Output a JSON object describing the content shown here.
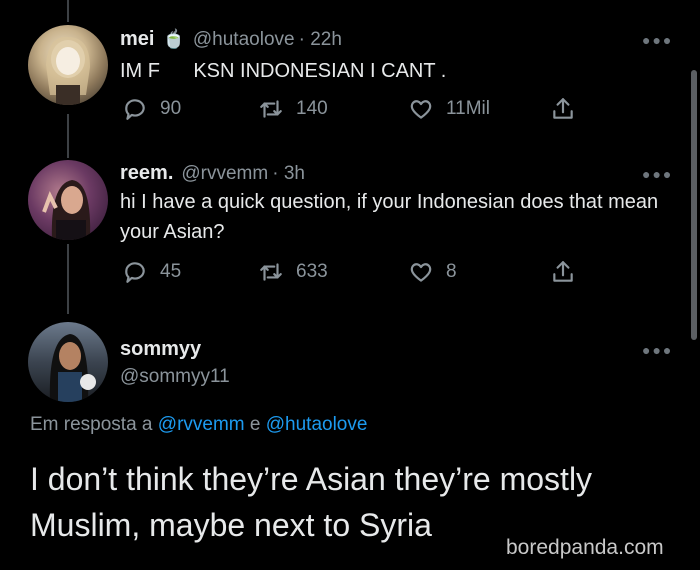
{
  "tweets": [
    {
      "name": "mei",
      "emoji": "🍵",
      "handle": "@hutaolove",
      "time": "· 22h",
      "text": "IM F      KSN INDONESIAN I CANT .",
      "replies": "90",
      "retweets": "140",
      "likes": "11Mil"
    },
    {
      "name": "reem.",
      "handle": "@rvvemm",
      "time": "· 3h",
      "text": "hi I have a quick question, if your Indonesian does that mean your Asian?",
      "replies": "45",
      "retweets": "633",
      "likes": "8"
    }
  ],
  "main_tweet": {
    "name": "sommyy",
    "handle": "@sommyy11",
    "reply_prefix": "Em resposta a ",
    "reply_user1": "@rvvemm",
    "reply_join": " e ",
    "reply_user2": "@hutaolove",
    "text": "I don’t think they’re Asian they’re mostly Muslim, maybe next to Syria"
  },
  "watermark": "boredpanda.com",
  "colors": {
    "link": "#1d9bf0",
    "muted": "#8b949b",
    "text": "#e7e9ea",
    "background": "#000000"
  }
}
